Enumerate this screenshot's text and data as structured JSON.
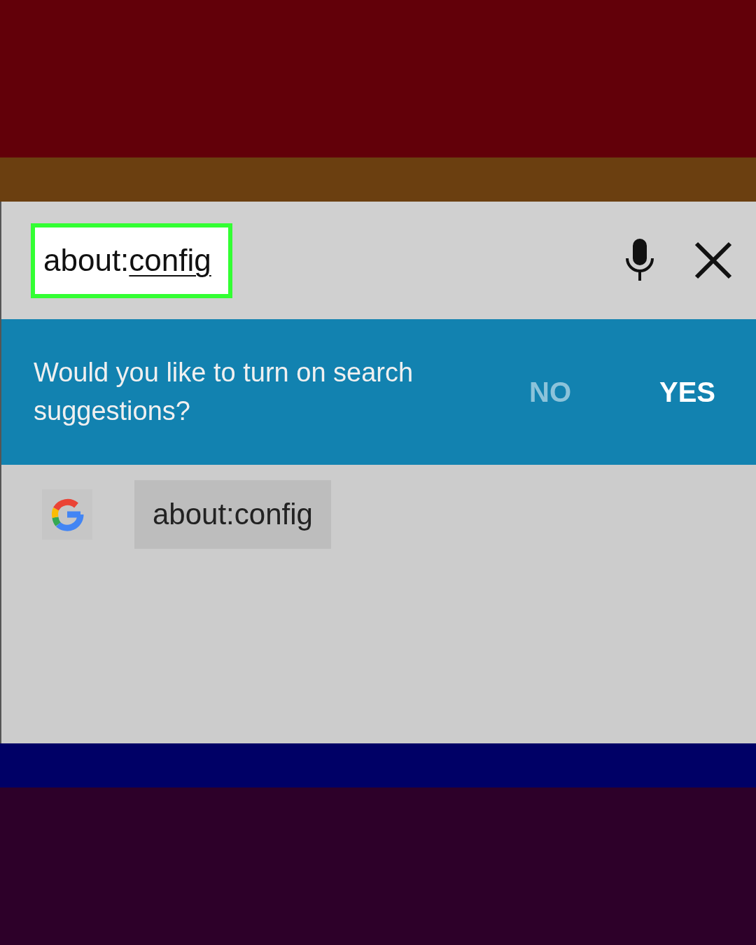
{
  "url_bar": {
    "value_committed": "about:",
    "value_composing": "config",
    "highlighted": true
  },
  "suggestion_prompt": {
    "text": "Would you like to turn on search suggestions?",
    "buttons": [
      {
        "label": "NO",
        "kind": "secondary"
      },
      {
        "label": "YES",
        "kind": "primary"
      }
    ]
  },
  "suggestions": [
    {
      "label": "about:config"
    }
  ]
}
